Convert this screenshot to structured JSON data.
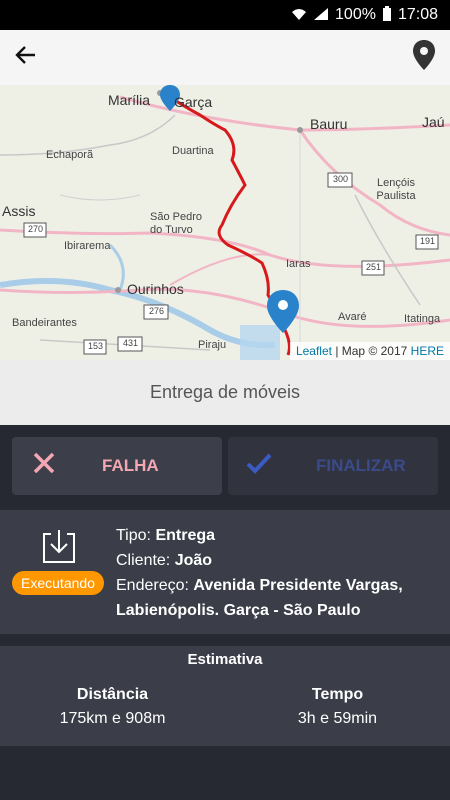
{
  "status_bar": {
    "battery": "100%",
    "time": "17:08"
  },
  "app_bar": {
    "back_icon": "arrow-left-icon",
    "location_icon": "map-pin-icon"
  },
  "map": {
    "cities": [
      "Marília",
      "Garça",
      "Bauru",
      "Jaú",
      "Echaporã",
      "Duartina",
      "Lençóis Paulista",
      "Assis",
      "São Pedro do Turvo",
      "Ibirarema",
      "Ourinhos",
      "Bandeirantes",
      "Piraju",
      "Iaras",
      "Avaré",
      "Itatinga"
    ],
    "roads": [
      "270",
      "300",
      "191",
      "251",
      "276",
      "153",
      "431"
    ],
    "attribution": {
      "leaflet": "Leaflet",
      "copyright": "| Map © 2017",
      "here": "HERE"
    }
  },
  "title": "Entrega de móveis",
  "actions": {
    "fail_label": "FALHA",
    "finish_label": "FINALIZAR"
  },
  "info": {
    "status": "Executando",
    "tipo_label": "Tipo:",
    "tipo_value": "Entrega",
    "cliente_label": "Cliente:",
    "cliente_value": "João",
    "endereco_label": "Endereço:",
    "endereco_value_1": "Avenida Presidente Vargas,",
    "endereco_value_2": "Labienópolis. Garça - São Paulo"
  },
  "estimate": {
    "title": "Estimativa",
    "distance_label": "Distância",
    "distance_value": "175km e 908m",
    "time_label": "Tempo",
    "time_value": "3h e 59min"
  }
}
